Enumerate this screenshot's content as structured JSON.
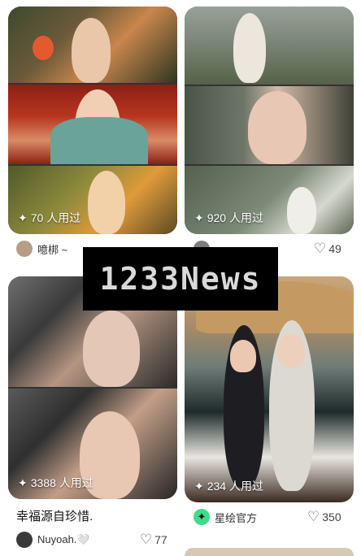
{
  "feed": {
    "cards": [
      {
        "uses": "70 人用过",
        "author": "噫梆 ~",
        "likes": ""
      },
      {
        "uses": "920 人用过",
        "author": "",
        "likes": "49"
      },
      {
        "uses": "3388 人用过",
        "title": "幸福源自珍惜.",
        "author": "Nuyoah.🤍",
        "likes": "77"
      },
      {
        "uses": "234 人用过",
        "author": "星绘官方",
        "likes": "350"
      }
    ]
  },
  "watermark": {
    "text": "1233News"
  },
  "icons": {
    "sparkle": "sparkle-icon",
    "heart": "heart-icon",
    "verified": "star-badge-icon"
  }
}
